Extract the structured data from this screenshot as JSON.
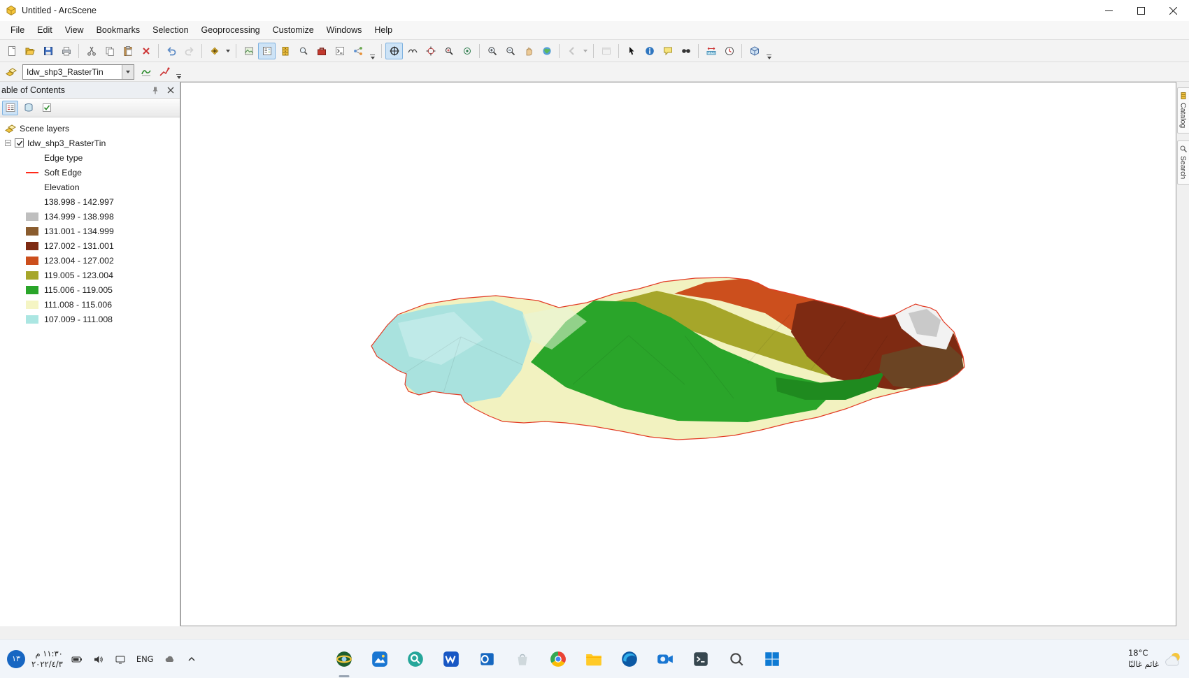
{
  "window": {
    "title": "Untitled - ArcScene",
    "controls": [
      "minimize-icon",
      "maximize-icon",
      "close-icon"
    ]
  },
  "menubar": {
    "items": [
      "File",
      "Edit",
      "View",
      "Bookmarks",
      "Selection",
      "Geoprocessing",
      "Customize",
      "Windows",
      "Help"
    ]
  },
  "standard_toolbar": {
    "icons": [
      "new-document",
      "open-folder",
      "save",
      "print",
      "cut",
      "copy",
      "paste",
      "delete",
      "undo",
      "redo",
      "add-data",
      "arcmap-launcher",
      "table-of-contents-toggle",
      "catalog-window",
      "search-window",
      "arctoolbox",
      "python-window",
      "modelbuilder"
    ]
  },
  "tools_toolbar": {
    "icons": [
      "navigate",
      "fly",
      "center-on-target",
      "zoom-to-target",
      "set-observer",
      "zoom-in",
      "zoom-out",
      "pan",
      "full-extent",
      "previous-extent",
      "viewer-window",
      "select-graphics",
      "identify",
      "html-popup",
      "find",
      "measure",
      "time-slider",
      "3d-analyst-cube"
    ]
  },
  "analyst_toolbar": {
    "layer_value": "Idw_shp3_RasterTin",
    "icons": [
      "interpolate-line",
      "steepest-path"
    ]
  },
  "toc": {
    "title": "able of Contents",
    "tools": [
      "list-by-drawing-order",
      "list-by-source",
      "list-by-visibility"
    ],
    "scene_layers_label": "Scene layers",
    "layer": {
      "name": "Idw_shp3_RasterTin",
      "checked": true
    },
    "edge_type_label": "Edge type",
    "soft_edge": {
      "label": "Soft Edge",
      "color": "#ff2a1a"
    },
    "elevation_label": "Elevation",
    "classes": [
      {
        "label": "138.998 - 142.997",
        "color": "#ffffff"
      },
      {
        "label": "134.999 - 138.998",
        "color": "#bfbfbf"
      },
      {
        "label": "131.001 - 134.999",
        "color": "#8a5c2e"
      },
      {
        "label": "127.002 - 131.001",
        "color": "#7e2a12"
      },
      {
        "label": "123.004 - 127.002",
        "color": "#cc4f1d"
      },
      {
        "label": "119.005 - 123.004",
        "color": "#a6a62a"
      },
      {
        "label": "115.006 - 119.005",
        "color": "#2aa52a"
      },
      {
        "label": "111.008 - 115.006",
        "color": "#f5f5c4"
      },
      {
        "label": "107.009 - 111.008",
        "color": "#abe6e2"
      }
    ]
  },
  "right_panel_tabs": [
    {
      "label": "Catalog"
    },
    {
      "label": "Search"
    }
  ],
  "taskbar": {
    "badge": "١٣",
    "time": "١١:٣٠ م",
    "date": "٢٠٢٢/٤/٣",
    "language": "ENG",
    "tray_icons": [
      "battery",
      "volume",
      "cast-monitor",
      "onedrive-cloud",
      "chevron-up"
    ],
    "app_icons": [
      "arcscene",
      "photos",
      "search-app",
      "word",
      "outlook",
      "store",
      "chrome",
      "file-explorer",
      "edge",
      "camera",
      "terminal",
      "windows-search",
      "start"
    ],
    "weather": {
      "temp": "18°C",
      "condition": "غائم غالبًا"
    }
  }
}
